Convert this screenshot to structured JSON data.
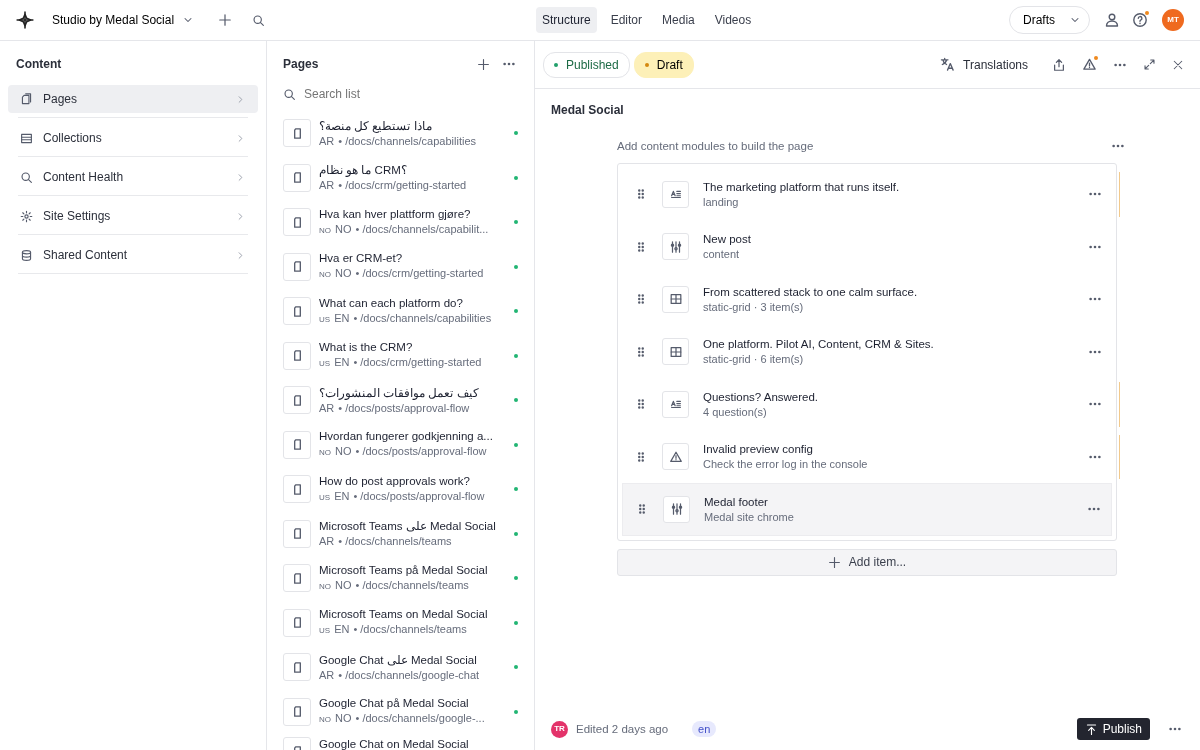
{
  "topbar": {
    "workspace": "Studio by Medal Social",
    "tabs": [
      {
        "label": "Structure",
        "selected": true
      },
      {
        "label": "Editor",
        "selected": false
      },
      {
        "label": "Media",
        "selected": false
      },
      {
        "label": "Videos",
        "selected": false
      }
    ],
    "perspective": "Drafts",
    "help_notice": true,
    "avatar": "MT"
  },
  "sidebar": {
    "title": "Content",
    "items": [
      {
        "label": "Pages",
        "selected": true
      },
      {
        "label": "Collections",
        "selected": false
      },
      {
        "label": "Content Health",
        "selected": false
      },
      {
        "label": "Site Settings",
        "selected": false
      },
      {
        "label": "Shared Content",
        "selected": false
      }
    ]
  },
  "pages": {
    "title": "Pages",
    "search": {
      "placeholder": "Search list"
    },
    "items": [
      {
        "title": "ماذا تستطيع كل منصة؟",
        "lang": "AR",
        "path": "• /docs/channels/capabilities",
        "published": true
      },
      {
        "title": "ما هو نظام CRM؟",
        "lang": "AR",
        "path": "• /docs/crm/getting-started",
        "published": true
      },
      {
        "title": "Hva kan hver plattform gjøre?",
        "flag": "NO",
        "lang": "NO",
        "path": "• /docs/channels/capabilit...",
        "published": true
      },
      {
        "title": "Hva er CRM-et?",
        "flag": "NO",
        "lang": "NO",
        "path": "• /docs/crm/getting-started",
        "published": true
      },
      {
        "title": "What can each platform do?",
        "flag": "US",
        "lang": "EN",
        "path": "• /docs/channels/capabilities",
        "published": true
      },
      {
        "title": "What is the CRM?",
        "flag": "US",
        "lang": "EN",
        "path": "• /docs/crm/getting-started",
        "published": true
      },
      {
        "title": "كيف تعمل موافقات المنشورات؟",
        "lang": "AR",
        "path": "• /docs/posts/approval-flow",
        "published": true
      },
      {
        "title": "Hvordan fungerer godkjenning a...",
        "flag": "NO",
        "lang": "NO",
        "path": "• /docs/posts/approval-flow",
        "published": true
      },
      {
        "title": "How do post approvals work?",
        "flag": "US",
        "lang": "EN",
        "path": "• /docs/posts/approval-flow",
        "published": true
      },
      {
        "title": "Microsoft Teams على Medal Social",
        "lang": "AR",
        "path": "• /docs/channels/teams",
        "published": true
      },
      {
        "title": "Microsoft Teams på Medal Social",
        "flag": "NO",
        "lang": "NO",
        "path": "• /docs/channels/teams",
        "published": true
      },
      {
        "title": "Microsoft Teams on Medal Social",
        "flag": "US",
        "lang": "EN",
        "path": "• /docs/channels/teams",
        "published": true
      },
      {
        "title": "Google Chat على Medal Social",
        "lang": "AR",
        "path": "• /docs/channels/google-chat",
        "published": true
      },
      {
        "title": "Google Chat på Medal Social",
        "flag": "NO",
        "lang": "NO",
        "path": "• /docs/channels/google-...",
        "published": true
      },
      {
        "title": "Google Chat on Medal Social"
      }
    ]
  },
  "document": {
    "statuses": [
      {
        "label": "Published",
        "kind": "published",
        "selected": false
      },
      {
        "label": "Draft",
        "kind": "draft",
        "selected": true
      }
    ],
    "translations": "Translations",
    "warning_notice": true,
    "title": "Medal Social",
    "hint": "Add content modules to build the page",
    "modules": [
      {
        "title": "The marketing platform that runs itself.",
        "subtitle": "landing",
        "kind": "text",
        "flagged": true,
        "selected": false
      },
      {
        "title": "New post",
        "subtitle": "content",
        "kind": "sliders",
        "flagged": false,
        "selected": false
      },
      {
        "title": "From scattered stack to one calm surface.",
        "subtitle": "static-grid · 3 item(s)",
        "kind": "grid",
        "flagged": false,
        "selected": false
      },
      {
        "title": "One platform. Pilot AI, Content, CRM & Sites.",
        "subtitle": "static-grid · 6 item(s)",
        "kind": "grid",
        "flagged": false,
        "selected": false
      },
      {
        "title": "Questions? Answered.",
        "subtitle": "4 question(s)",
        "kind": "text",
        "flagged": true,
        "selected": false
      },
      {
        "title": "Invalid preview config",
        "subtitle": "Check the error log in the console",
        "kind": "warning",
        "flagged": true,
        "selected": false
      },
      {
        "title": "Medal footer",
        "subtitle": "Medal site chrome",
        "kind": "sliders",
        "flagged": false,
        "selected": true
      }
    ],
    "add_button": "Add item...",
    "footer": {
      "avatar": "TR",
      "edited": "Edited 2 days ago",
      "locale": "en",
      "publish": "Publish"
    }
  }
}
